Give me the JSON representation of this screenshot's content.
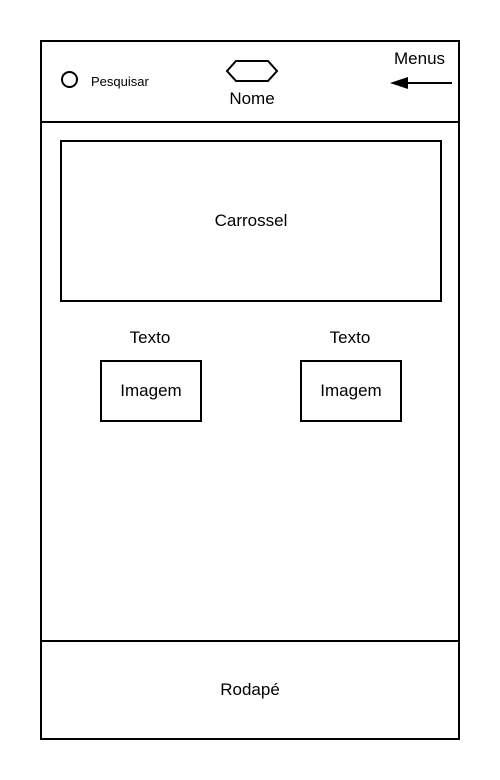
{
  "header": {
    "search_label": "Pesquisar",
    "search_icon": "circle-icon",
    "logo_icon": "hexagon-icon",
    "brand_name": "Nome",
    "menus_label": "Menus",
    "menus_icon": "arrow-left-icon"
  },
  "main": {
    "carousel_label": "Carrossel",
    "cards": [
      {
        "text": "Texto",
        "image_label": "Imagem"
      },
      {
        "text": "Texto",
        "image_label": "Imagem"
      }
    ]
  },
  "footer": {
    "label": "Rodapé"
  },
  "colors": {
    "stroke": "#000000",
    "background": "#ffffff"
  }
}
